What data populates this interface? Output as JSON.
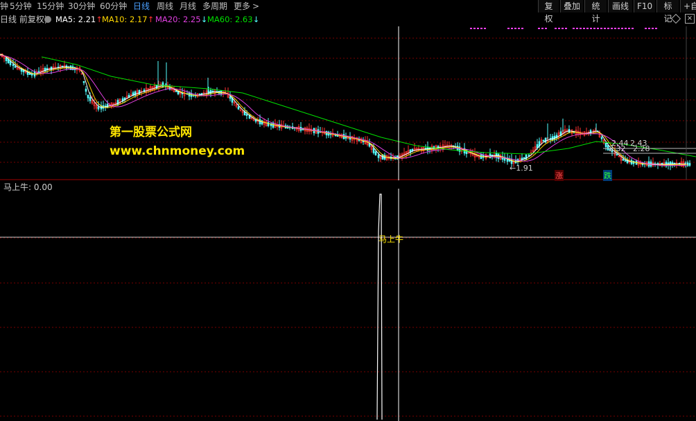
{
  "toolbar": {
    "periods": [
      {
        "label": "钟",
        "active": false
      },
      {
        "label": "5分钟",
        "active": false
      },
      {
        "label": "15分钟",
        "active": false
      },
      {
        "label": "30分钟",
        "active": false
      },
      {
        "label": "60分钟",
        "active": false
      },
      {
        "label": "日线",
        "active": true
      },
      {
        "label": "周线",
        "active": false
      },
      {
        "label": "月线",
        "active": false
      },
      {
        "label": "多周期",
        "active": false
      },
      {
        "label": "更多",
        "active": false
      }
    ],
    "more_arrow": ">",
    "buttons": [
      "复权",
      "叠加",
      "统计",
      "画线",
      "F10",
      "标记",
      "+自"
    ]
  },
  "infobar": {
    "chart_mode": "日线 前复权)",
    "ma5": {
      "label": "MA5:",
      "value": "2.21",
      "arrow": "↑",
      "color": "#ffffff"
    },
    "ma10": {
      "label": "MA10:",
      "value": "2.17",
      "arrow": "↑",
      "color": "#ffd700"
    },
    "ma20": {
      "label": "MA20:",
      "value": "2.25",
      "arrow": "↓",
      "color": "#e040e0"
    },
    "ma60": {
      "label": "MA60:",
      "value": "2.63",
      "arrow": "↓",
      "color": "#00e000"
    }
  },
  "watermark": {
    "line1": "第一股票公式网",
    "line2": "www.chnmoney.com"
  },
  "price_annotations": {
    "low": "←1.91",
    "high_a": "2.44",
    "high_b": "2.43",
    "mid_a": "2.32",
    "mid_b": "2.28",
    "rise_badge": "涨",
    "fall_badge": "跌"
  },
  "indicator": {
    "name": "马上牛:",
    "value": "0.00",
    "signal_label": "马上牛"
  },
  "colors": {
    "up": "#ff3232",
    "down": "#54ffff",
    "ma5": "#ffffff",
    "ma10": "#ffd700",
    "ma20": "#e040e0",
    "ma60": "#00e000",
    "grid": "#7a0000",
    "active": "#4aa0ff"
  }
}
